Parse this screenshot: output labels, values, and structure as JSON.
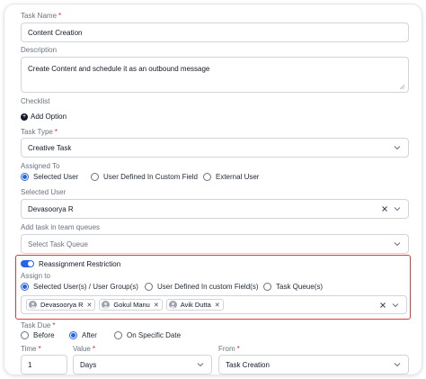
{
  "task_name": {
    "label": "Task Name",
    "value": "Content Creation"
  },
  "description": {
    "label": "Description",
    "value": "Create Content and schedule it as an outbound message"
  },
  "checklist": {
    "label": "Checklist",
    "add_option": "Add Option"
  },
  "task_type": {
    "label": "Task Type",
    "value": "Creative Task"
  },
  "assigned_to": {
    "label": "Assigned To",
    "options": [
      "Selected User",
      "User Defined In Custom Field",
      "External User"
    ],
    "selected": "Selected User"
  },
  "selected_user": {
    "label": "Selected User",
    "value": "Devasoorya R"
  },
  "team_queues": {
    "label": "Add task in team queues",
    "placeholder": "Select Task Queue"
  },
  "reassignment": {
    "toggle_label": "Reassignment Restriction",
    "toggle_on": true,
    "assign_to_label": "Assign to",
    "options": [
      "Selected User(s) / User Group(s)",
      "User Defined In custom Field(s)",
      "Task Queue(s)"
    ],
    "selected": "Selected User(s) / User Group(s)",
    "chips": [
      "Devasoorya R",
      "Gokul Manu",
      "Avik Dutta"
    ],
    "highlight_color": "#e53935"
  },
  "task_due": {
    "label": "Task Due",
    "options": [
      "Before",
      "After",
      "On Specific Date"
    ],
    "selected": "After"
  },
  "time": {
    "label": "Time",
    "value": "1"
  },
  "value": {
    "label": "Value",
    "value": "Days"
  },
  "from": {
    "label": "From",
    "value": "Task Creation"
  },
  "colors": {
    "accent": "#2563eb",
    "required": "#dc2626"
  }
}
